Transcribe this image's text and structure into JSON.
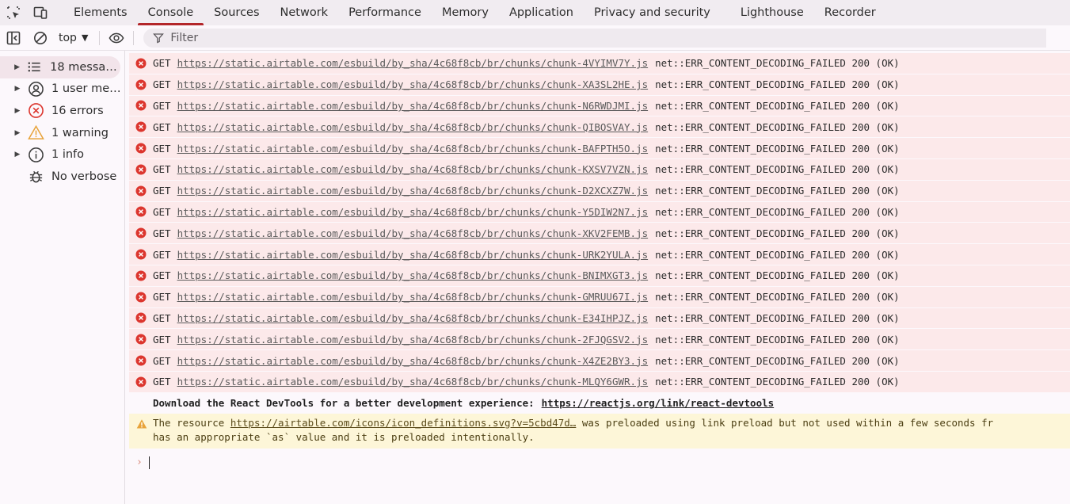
{
  "tabs": [
    "Elements",
    "Console",
    "Sources",
    "Network",
    "Performance",
    "Memory",
    "Application",
    "Privacy and security",
    "Lighthouse",
    "Recorder"
  ],
  "active_tab": "Console",
  "toolbar": {
    "context": "top",
    "filter_placeholder": "Filter"
  },
  "sidebar": [
    {
      "label": "18 messag…",
      "icon": "list-icon",
      "expandable": true
    },
    {
      "label": "1 user me…",
      "icon": "user-icon",
      "expandable": true
    },
    {
      "label": "16 errors",
      "icon": "error-icon",
      "expandable": true
    },
    {
      "label": "1 warning",
      "icon": "warning-icon",
      "expandable": true
    },
    {
      "label": "1 info",
      "icon": "info-icon",
      "expandable": true
    },
    {
      "label": "No verbose",
      "icon": "bug-icon",
      "expandable": false
    }
  ],
  "errors": [
    {
      "method": "GET",
      "url": "https://static.airtable.com/esbuild/by_sha/4c68f8cb/br/chunks/chunk-4VYIMV7Y.js",
      "message": "net::ERR_CONTENT_DECODING_FAILED 200 (OK)"
    },
    {
      "method": "GET",
      "url": "https://static.airtable.com/esbuild/by_sha/4c68f8cb/br/chunks/chunk-XA3SL2HE.js",
      "message": "net::ERR_CONTENT_DECODING_FAILED 200 (OK)"
    },
    {
      "method": "GET",
      "url": "https://static.airtable.com/esbuild/by_sha/4c68f8cb/br/chunks/chunk-N6RWDJMI.js",
      "message": "net::ERR_CONTENT_DECODING_FAILED 200 (OK)"
    },
    {
      "method": "GET",
      "url": "https://static.airtable.com/esbuild/by_sha/4c68f8cb/br/chunks/chunk-QIBOSVAY.js",
      "message": "net::ERR_CONTENT_DECODING_FAILED 200 (OK)"
    },
    {
      "method": "GET",
      "url": "https://static.airtable.com/esbuild/by_sha/4c68f8cb/br/chunks/chunk-BAFPTH5O.js",
      "message": "net::ERR_CONTENT_DECODING_FAILED 200 (OK)"
    },
    {
      "method": "GET",
      "url": "https://static.airtable.com/esbuild/by_sha/4c68f8cb/br/chunks/chunk-KXSV7VZN.js",
      "message": "net::ERR_CONTENT_DECODING_FAILED 200 (OK)"
    },
    {
      "method": "GET",
      "url": "https://static.airtable.com/esbuild/by_sha/4c68f8cb/br/chunks/chunk-D2XCXZ7W.js",
      "message": "net::ERR_CONTENT_DECODING_FAILED 200 (OK)"
    },
    {
      "method": "GET",
      "url": "https://static.airtable.com/esbuild/by_sha/4c68f8cb/br/chunks/chunk-Y5DIW2N7.js",
      "message": "net::ERR_CONTENT_DECODING_FAILED 200 (OK)"
    },
    {
      "method": "GET",
      "url": "https://static.airtable.com/esbuild/by_sha/4c68f8cb/br/chunks/chunk-XKV2FEMB.js",
      "message": "net::ERR_CONTENT_DECODING_FAILED 200 (OK)"
    },
    {
      "method": "GET",
      "url": "https://static.airtable.com/esbuild/by_sha/4c68f8cb/br/chunks/chunk-URK2YULA.js",
      "message": "net::ERR_CONTENT_DECODING_FAILED 200 (OK)"
    },
    {
      "method": "GET",
      "url": "https://static.airtable.com/esbuild/by_sha/4c68f8cb/br/chunks/chunk-BNIMXGT3.js",
      "message": "net::ERR_CONTENT_DECODING_FAILED 200 (OK)"
    },
    {
      "method": "GET",
      "url": "https://static.airtable.com/esbuild/by_sha/4c68f8cb/br/chunks/chunk-GMRUU67I.js",
      "message": "net::ERR_CONTENT_DECODING_FAILED 200 (OK)"
    },
    {
      "method": "GET",
      "url": "https://static.airtable.com/esbuild/by_sha/4c68f8cb/br/chunks/chunk-E34IHPJZ.js",
      "message": "net::ERR_CONTENT_DECODING_FAILED 200 (OK)"
    },
    {
      "method": "GET",
      "url": "https://static.airtable.com/esbuild/by_sha/4c68f8cb/br/chunks/chunk-2FJQGSV2.js",
      "message": "net::ERR_CONTENT_DECODING_FAILED 200 (OK)"
    },
    {
      "method": "GET",
      "url": "https://static.airtable.com/esbuild/by_sha/4c68f8cb/br/chunks/chunk-X4ZE2BY3.js",
      "message": "net::ERR_CONTENT_DECODING_FAILED 200 (OK)"
    },
    {
      "method": "GET",
      "url": "https://static.airtable.com/esbuild/by_sha/4c68f8cb/br/chunks/chunk-MLQY6GWR.js",
      "message": "net::ERR_CONTENT_DECODING_FAILED 200 (OK)"
    }
  ],
  "devtools_message": {
    "text": "Download the React DevTools for a better development experience:",
    "link": "https://reactjs.org/link/react-devtools"
  },
  "warning_message": {
    "prefix": "The resource",
    "link": "https://airtable.com/icons/icon_definitions.svg?v=5cbd47d…",
    "suffix": "was preloaded using link preload but not used within a few seconds fr",
    "line2": "has an appropriate `as` value and it is preloaded intentionally."
  },
  "prompt_symbol": "›",
  "colors": {
    "active_tab_underline": "#b3262a",
    "error_bg": "#fce9ea",
    "error_icon": "#dc362e",
    "warning_bg": "#fdf6d8",
    "warning_icon": "#e8a33a"
  }
}
